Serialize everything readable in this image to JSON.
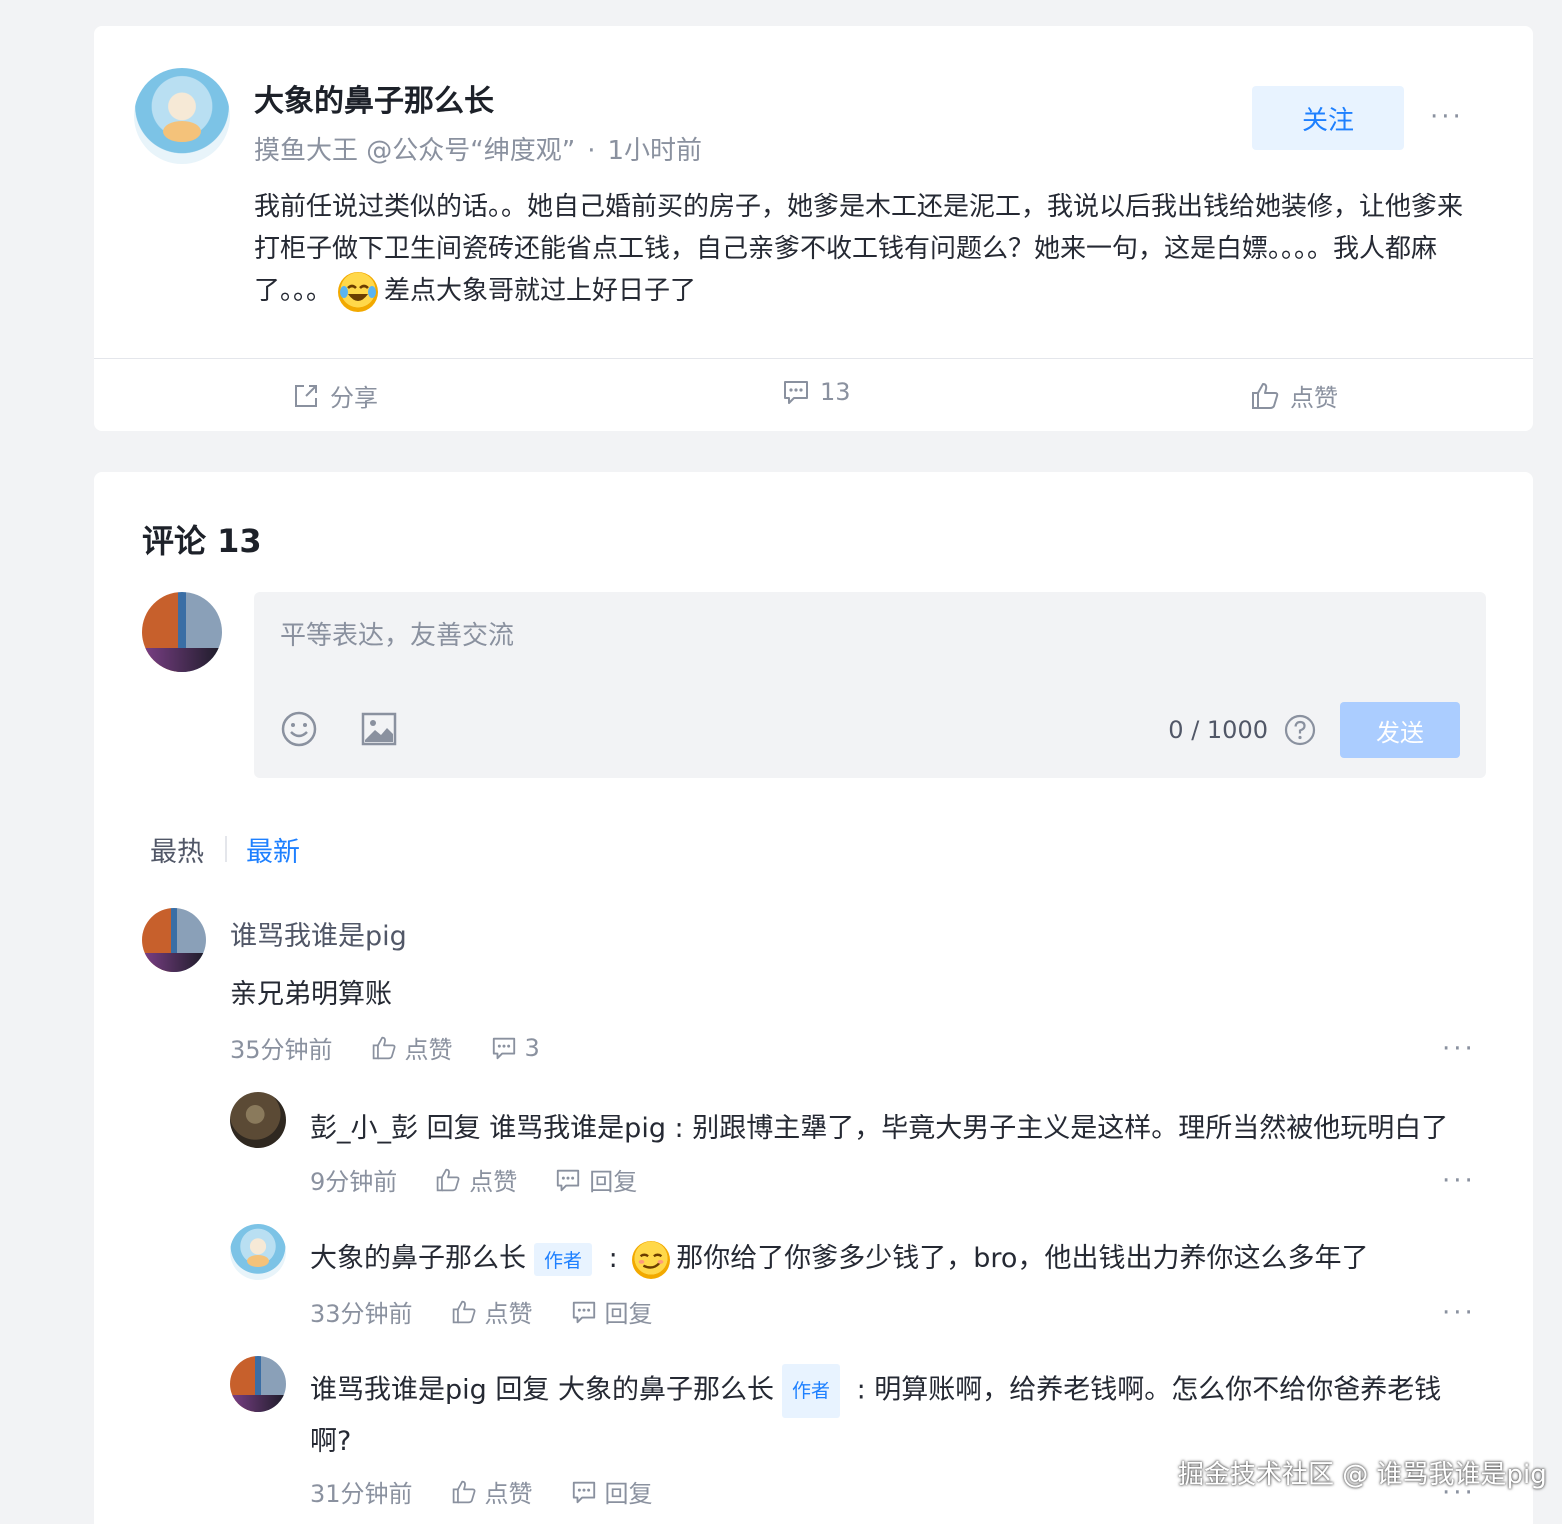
{
  "post": {
    "author_name": "大象的鼻子那么长",
    "author_title": "摸鱼大王 @公众号“绅度观”",
    "time": "1小时前",
    "follow_label": "关注",
    "more_label": "···",
    "body_part1": "我前任说过类似的话。。她自己婚前买的房子，她爹是木工还是泥工，我说以后我出钱给她装修，让他爹来打柜子做下卫生间瓷砖还能省点工钱，自己亲爹不收工钱有问题么？她来一句，这是白嫖。。。。我人都麻了。。。",
    "body_emoji": "laugh-cry-emoji",
    "body_part2": "差点大象哥就过上好日子了",
    "actions": {
      "share_label": "分享",
      "comment_count": "13",
      "like_label": "点赞"
    }
  },
  "comments": {
    "title": "评论 13",
    "editor": {
      "placeholder": "平等表达，友善交流",
      "counter": "0 / 1000",
      "send_label": "发送"
    },
    "sort": {
      "hot_label": "最热",
      "new_label": "最新",
      "active": "最新"
    },
    "list": [
      {
        "name": "谁骂我谁是pig",
        "content": "亲兄弟明算账",
        "time": "35分钟前",
        "like_label": "点赞",
        "reply_count": "3",
        "replies": [
          {
            "name": "彭_小_彭",
            "reply_word": "回复",
            "reply_to": "谁骂我谁是pig",
            "separator": " : ",
            "content": "别跟博主犟了，毕竟大男子主义是这样。理所当然被他玩明白了",
            "time": "9分钟前",
            "like_label": "点赞",
            "reply_label": "回复"
          },
          {
            "name": "大象的鼻子那么长",
            "author_tag": "作者",
            "separator": " : ",
            "emoji": "smirk-emoji",
            "content": "那你给了你爹多少钱了，bro，他出钱出力养你这么多年了",
            "time": "33分钟前",
            "like_label": "点赞",
            "reply_label": "回复"
          },
          {
            "name": "谁骂我谁是pig",
            "reply_word": "回复",
            "reply_to": "大象的鼻子那么长",
            "author_tag": "作者",
            "separator": " : ",
            "content": "明算账啊，给养老钱啊。怎么你不给你爸养老钱啊?",
            "time": "31分钟前",
            "like_label": "点赞",
            "reply_label": "回复"
          }
        ]
      }
    ]
  },
  "watermark": "掘金技术社区 @ 谁骂我谁是pig"
}
